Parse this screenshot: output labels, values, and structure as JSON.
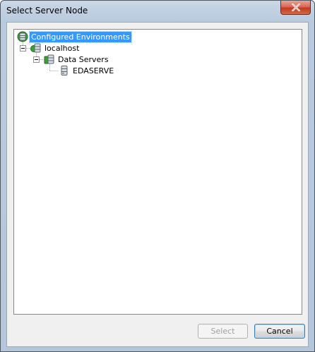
{
  "window": {
    "title": "Select Server Node"
  },
  "tree": {
    "nodes": [
      {
        "label": "Configured Environments",
        "icon": "environments-db-icon",
        "level": 0,
        "selected": true
      },
      {
        "label": "localhost",
        "icon": "server-node-icon",
        "level": 1,
        "expanded": true
      },
      {
        "label": "Data Servers",
        "icon": "data-servers-icon",
        "level": 2,
        "expanded": true
      },
      {
        "label": "EDASERVE",
        "icon": "database-icon",
        "level": 3
      }
    ]
  },
  "buttons": {
    "select_label": "Select",
    "cancel_label": "Cancel"
  },
  "colors": {
    "selection": "#3399ff",
    "close_button": "#c13a22",
    "title_bar": "#b9cadd"
  }
}
